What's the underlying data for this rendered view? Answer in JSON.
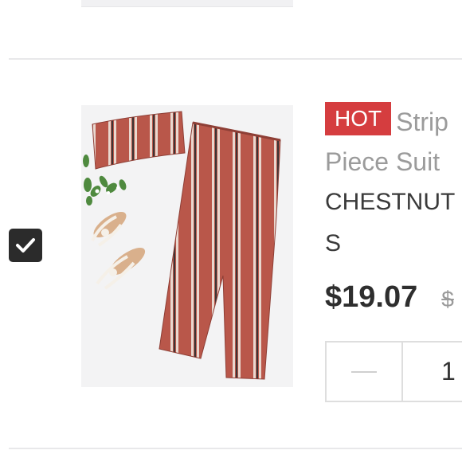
{
  "product": {
    "badge": "HOT",
    "title_line1": "Strip",
    "title_line2": "Piece Suit",
    "color": "CHESTNUT",
    "size": "S",
    "price": "$19.07",
    "original_price_partial": "$",
    "quantity": "1",
    "image_alt": "Striped bandeau top and wide leg pants set",
    "selected": true
  },
  "colors": {
    "badge_bg": "#d53d3f",
    "checkbox_bg": "#2b2b2b",
    "fabric": "#b9574a"
  },
  "icons": {
    "checkbox": "check-icon",
    "decrease": "minus-icon"
  }
}
